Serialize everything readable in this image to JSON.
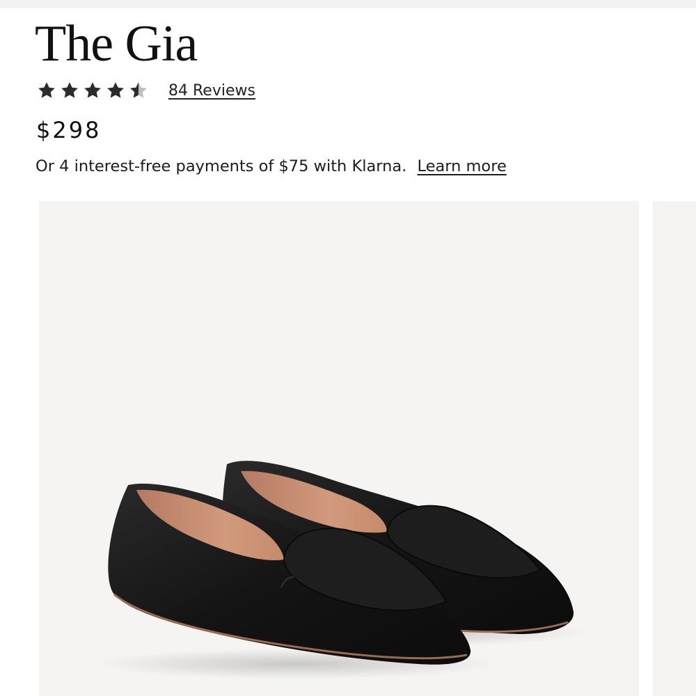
{
  "product": {
    "title": "The Gia",
    "rating": 4.5,
    "rating_max": 5,
    "reviews_label": "84 Reviews",
    "price": "$298",
    "klarna_text": "Or 4 interest-free payments of $75 with Klarna.",
    "learn_more": "Learn more"
  },
  "icons": {
    "star": "star-icon",
    "star_half": "star-half-icon"
  },
  "colors": {
    "text": "#111111",
    "star": "#2b2b2b",
    "star_empty": "#bdbdbd",
    "image_bg": "#f5f4f2",
    "shoe": "#141414",
    "lining": "#c98e72"
  }
}
